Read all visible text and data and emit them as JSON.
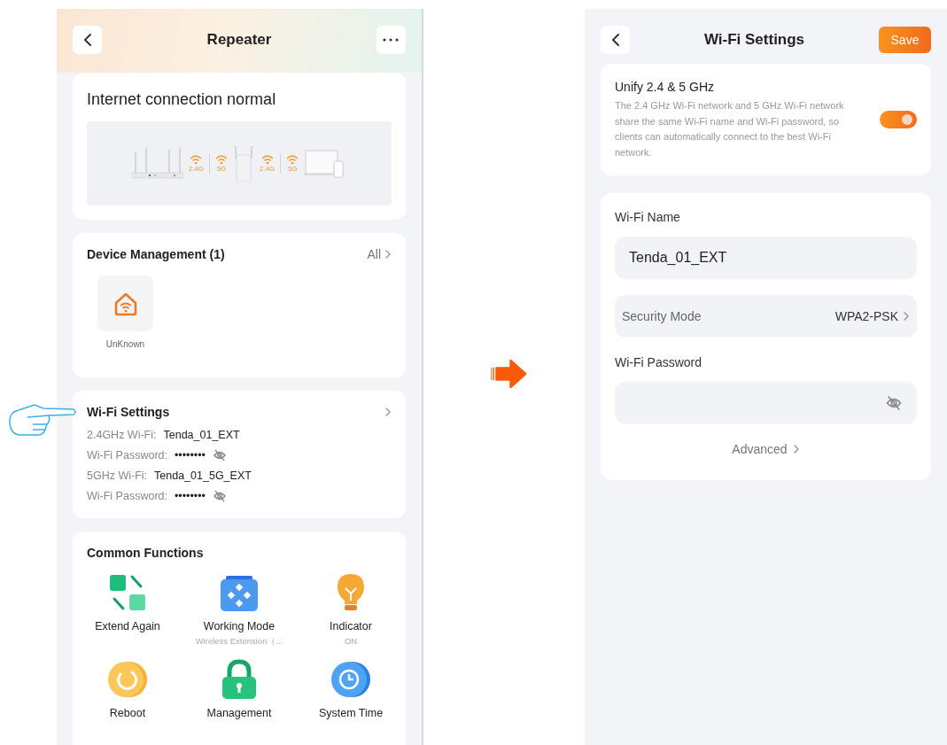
{
  "left_screen": {
    "title": "Repeater",
    "status_card": {
      "title": "Internet connection normal",
      "uplink_bands": [
        "2.4G",
        "5G"
      ],
      "downlink_bands": [
        "2.4G",
        "5G"
      ]
    },
    "device_card": {
      "title": "Device Management (1)",
      "link": "All",
      "devices": [
        {
          "name": "UnKnown"
        }
      ]
    },
    "wifi_card": {
      "title": "Wi-Fi Settings",
      "rows": [
        {
          "label": "2.4GHz Wi-Fi:",
          "value": "Tenda_01_EXT",
          "kind": "text"
        },
        {
          "label": "Wi-Fi Password:",
          "value": "••••••••",
          "kind": "password"
        },
        {
          "label": "5GHz Wi-Fi:",
          "value": "Tenda_01_5G_EXT",
          "kind": "text"
        },
        {
          "label": "Wi-Fi Password:",
          "value": "••••••••",
          "kind": "password"
        }
      ]
    },
    "functions_card": {
      "title": "Common Functions",
      "items": [
        {
          "label": "Extend Again",
          "kind": "extend"
        },
        {
          "label": "Working Mode",
          "sub": "Wireless Extension（...",
          "kind": "mode"
        },
        {
          "label": "Indicator",
          "sub": "ON",
          "kind": "indicator"
        },
        {
          "label": "Reboot",
          "kind": "reboot"
        },
        {
          "label": "Management",
          "kind": "lock"
        },
        {
          "label": "System Time",
          "kind": "clock"
        }
      ]
    }
  },
  "right_screen": {
    "title": "Wi-Fi Settings",
    "save": "Save",
    "unify": {
      "title": "Unify 2.4 & 5 GHz",
      "description": "The 2.4 GHz Wi-Fi network and 5 GHz Wi-Fi network share the same Wi-Fi name and Wi-Fi password, so clients can automatically connect to the best Wi-Fi network.",
      "on": true
    },
    "name_label": "Wi-Fi Name",
    "name_value": "Tenda_01_EXT",
    "security": {
      "label": "Security Mode",
      "value": "WPA2-PSK"
    },
    "password_label": "Wi-Fi Password",
    "advanced": "Advanced"
  }
}
